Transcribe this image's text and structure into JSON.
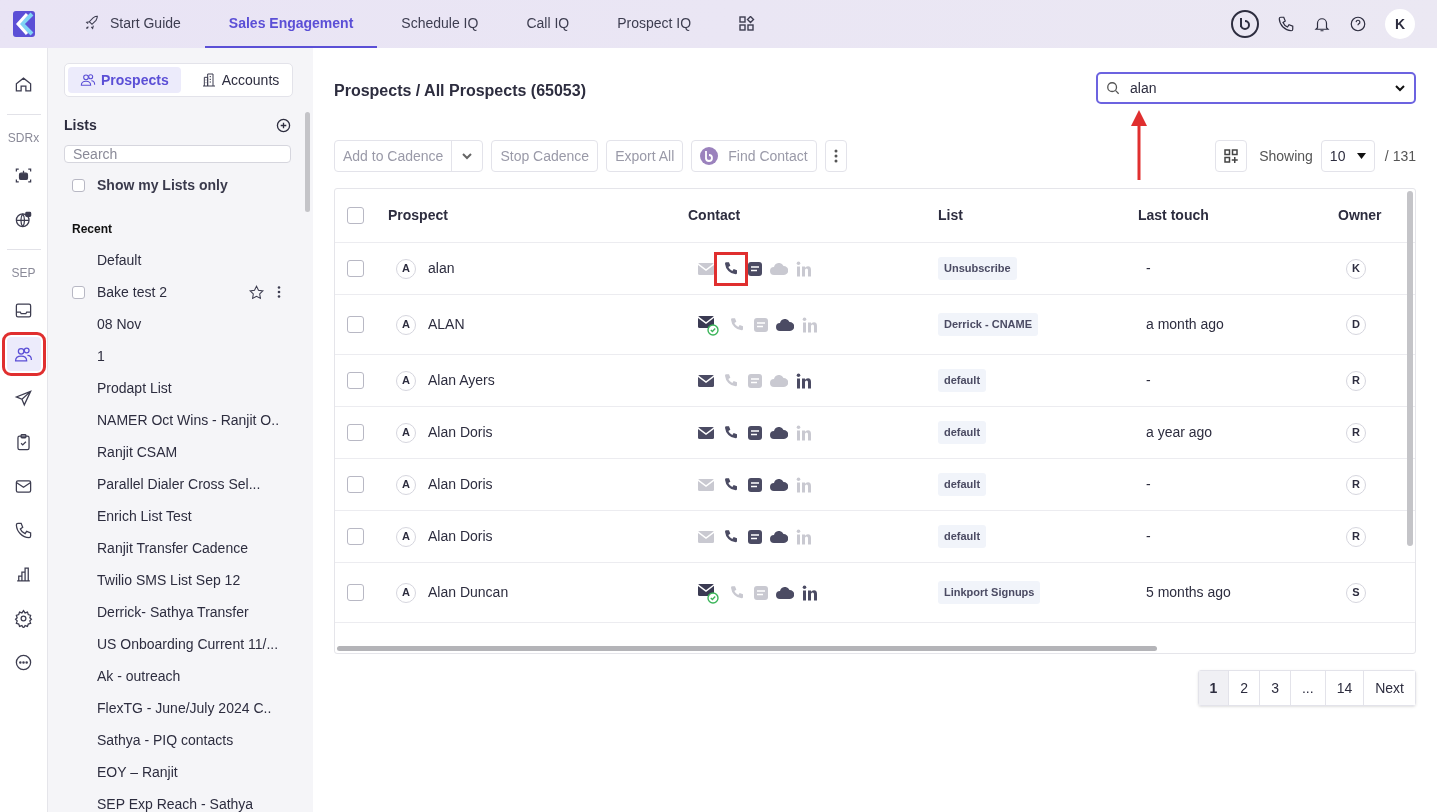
{
  "top_nav": {
    "tabs": [
      {
        "label": "Start Guide",
        "selected": false
      },
      {
        "label": "Sales Engagement",
        "selected": true
      },
      {
        "label": "Schedule IQ",
        "selected": false
      },
      {
        "label": "Call IQ",
        "selected": false
      },
      {
        "label": "Prospect IQ",
        "selected": false
      }
    ],
    "avatar": "K"
  },
  "rail": [
    {
      "kind": "home",
      "selected": false,
      "marked": false
    },
    {
      "kind": "divider"
    },
    {
      "kind": "label",
      "label": "SDRx"
    },
    {
      "kind": "bot",
      "selected": false,
      "marked": false
    },
    {
      "kind": "globe",
      "selected": false,
      "marked": false
    },
    {
      "kind": "divider"
    },
    {
      "kind": "label",
      "label": "SEP"
    },
    {
      "kind": "inbox",
      "selected": false,
      "marked": false
    },
    {
      "kind": "people",
      "selected": true,
      "marked": true
    },
    {
      "kind": "send",
      "selected": false,
      "marked": false
    },
    {
      "kind": "clipboard",
      "selected": false,
      "marked": false
    },
    {
      "kind": "mail",
      "selected": false,
      "marked": false
    },
    {
      "kind": "phone",
      "selected": false,
      "marked": false
    },
    {
      "kind": "chart",
      "selected": false,
      "marked": false
    },
    {
      "kind": "gear",
      "selected": false,
      "marked": false
    },
    {
      "kind": "more",
      "selected": false,
      "marked": false
    }
  ],
  "sidebar": {
    "toggle": [
      {
        "label": "Prospects",
        "selected": true
      },
      {
        "label": "Accounts",
        "selected": false
      }
    ],
    "lists_title": "Lists",
    "search_placeholder": "Search",
    "show_mine": {
      "label": "Show my Lists only",
      "checked": false
    },
    "section": "Recent",
    "items": [
      {
        "label": "Default",
        "hovered": false
      },
      {
        "label": "Bake test 2",
        "hovered": true,
        "checked": false
      },
      {
        "label": "08 Nov",
        "hovered": false
      },
      {
        "label": "1",
        "hovered": false
      },
      {
        "label": "Prodapt List",
        "hovered": false
      },
      {
        "label": "NAMER Oct Wins - Ranjit O..",
        "hovered": false
      },
      {
        "label": "Ranjit CSAM",
        "hovered": false
      },
      {
        "label": "Parallel Dialer Cross Sel...",
        "hovered": false
      },
      {
        "label": "Enrich List Test",
        "hovered": false
      },
      {
        "label": "Ranjit Transfer Cadence",
        "hovered": false
      },
      {
        "label": "Twilio SMS List Sep 12",
        "hovered": false
      },
      {
        "label": "Derrick- Sathya Transfer",
        "hovered": false
      },
      {
        "label": "US Onboarding Current 11/...",
        "hovered": false
      },
      {
        "label": "Ak - outreach",
        "hovered": false
      },
      {
        "label": "FlexTG - June/July 2024 C..",
        "hovered": false
      },
      {
        "label": "Sathya - PIQ contacts",
        "hovered": false
      },
      {
        "label": "EOY – Ranjit",
        "hovered": false
      },
      {
        "label": "SEP Exp Reach - Sathya",
        "hovered": false
      }
    ]
  },
  "main": {
    "title": "Prospects / All Prospects (65053)",
    "search": {
      "value": "alan",
      "marked": true
    },
    "toolbar": [
      "Add to Cadence",
      "Stop Cadence",
      "Export All",
      "Find Contact"
    ],
    "showing_label": "Showing",
    "page_size": "10",
    "total": "/ 131",
    "table": {
      "select_all_checked": false,
      "columns": [
        "Prospect",
        "Contact",
        "List",
        "Last touch",
        "Owner"
      ],
      "rows": [
        {
          "checked": false,
          "initial": "A",
          "name": "alan",
          "email": false,
          "email_verified": false,
          "phone": true,
          "sms": true,
          "cloud": false,
          "linkedin": false,
          "phone_marked": true,
          "list": "Unsubscribe",
          "last_touch": "-",
          "owner": "K"
        },
        {
          "checked": false,
          "initial": "A",
          "name": "ALAN",
          "email": true,
          "email_verified": true,
          "phone": false,
          "sms": false,
          "cloud": true,
          "linkedin": false,
          "phone_marked": false,
          "list": "Derrick - CNAME",
          "last_touch": "a month ago",
          "owner": "D"
        },
        {
          "checked": false,
          "initial": "A",
          "name": "Alan Ayers",
          "email": true,
          "email_verified": false,
          "phone": false,
          "sms": false,
          "cloud": false,
          "linkedin": true,
          "phone_marked": false,
          "list": "default",
          "last_touch": "-",
          "owner": "R"
        },
        {
          "checked": false,
          "initial": "A",
          "name": "Alan Doris",
          "email": true,
          "email_verified": false,
          "phone": true,
          "sms": true,
          "cloud": true,
          "linkedin": false,
          "phone_marked": false,
          "list": "default",
          "last_touch": "a year ago",
          "owner": "R"
        },
        {
          "checked": false,
          "initial": "A",
          "name": "Alan Doris",
          "email": false,
          "email_verified": false,
          "phone": true,
          "sms": true,
          "cloud": true,
          "linkedin": false,
          "phone_marked": false,
          "list": "default",
          "last_touch": "-",
          "owner": "R"
        },
        {
          "checked": false,
          "initial": "A",
          "name": "Alan Doris",
          "email": false,
          "email_verified": false,
          "phone": true,
          "sms": true,
          "cloud": true,
          "linkedin": false,
          "phone_marked": false,
          "list": "default",
          "last_touch": "-",
          "owner": "R"
        },
        {
          "checked": false,
          "initial": "A",
          "name": "Alan Duncan",
          "email": true,
          "email_verified": true,
          "phone": false,
          "sms": false,
          "cloud": true,
          "linkedin": true,
          "phone_marked": false,
          "list": "Linkport Signups",
          "last_touch": "5 months ago",
          "owner": "S"
        }
      ]
    },
    "pagination": [
      {
        "label": "1",
        "selected": true
      },
      {
        "label": "2",
        "selected": false
      },
      {
        "label": "3",
        "selected": false
      },
      {
        "label": "...",
        "selected": false
      },
      {
        "label": "14",
        "selected": false
      },
      {
        "label": "Next",
        "selected": false
      }
    ]
  }
}
